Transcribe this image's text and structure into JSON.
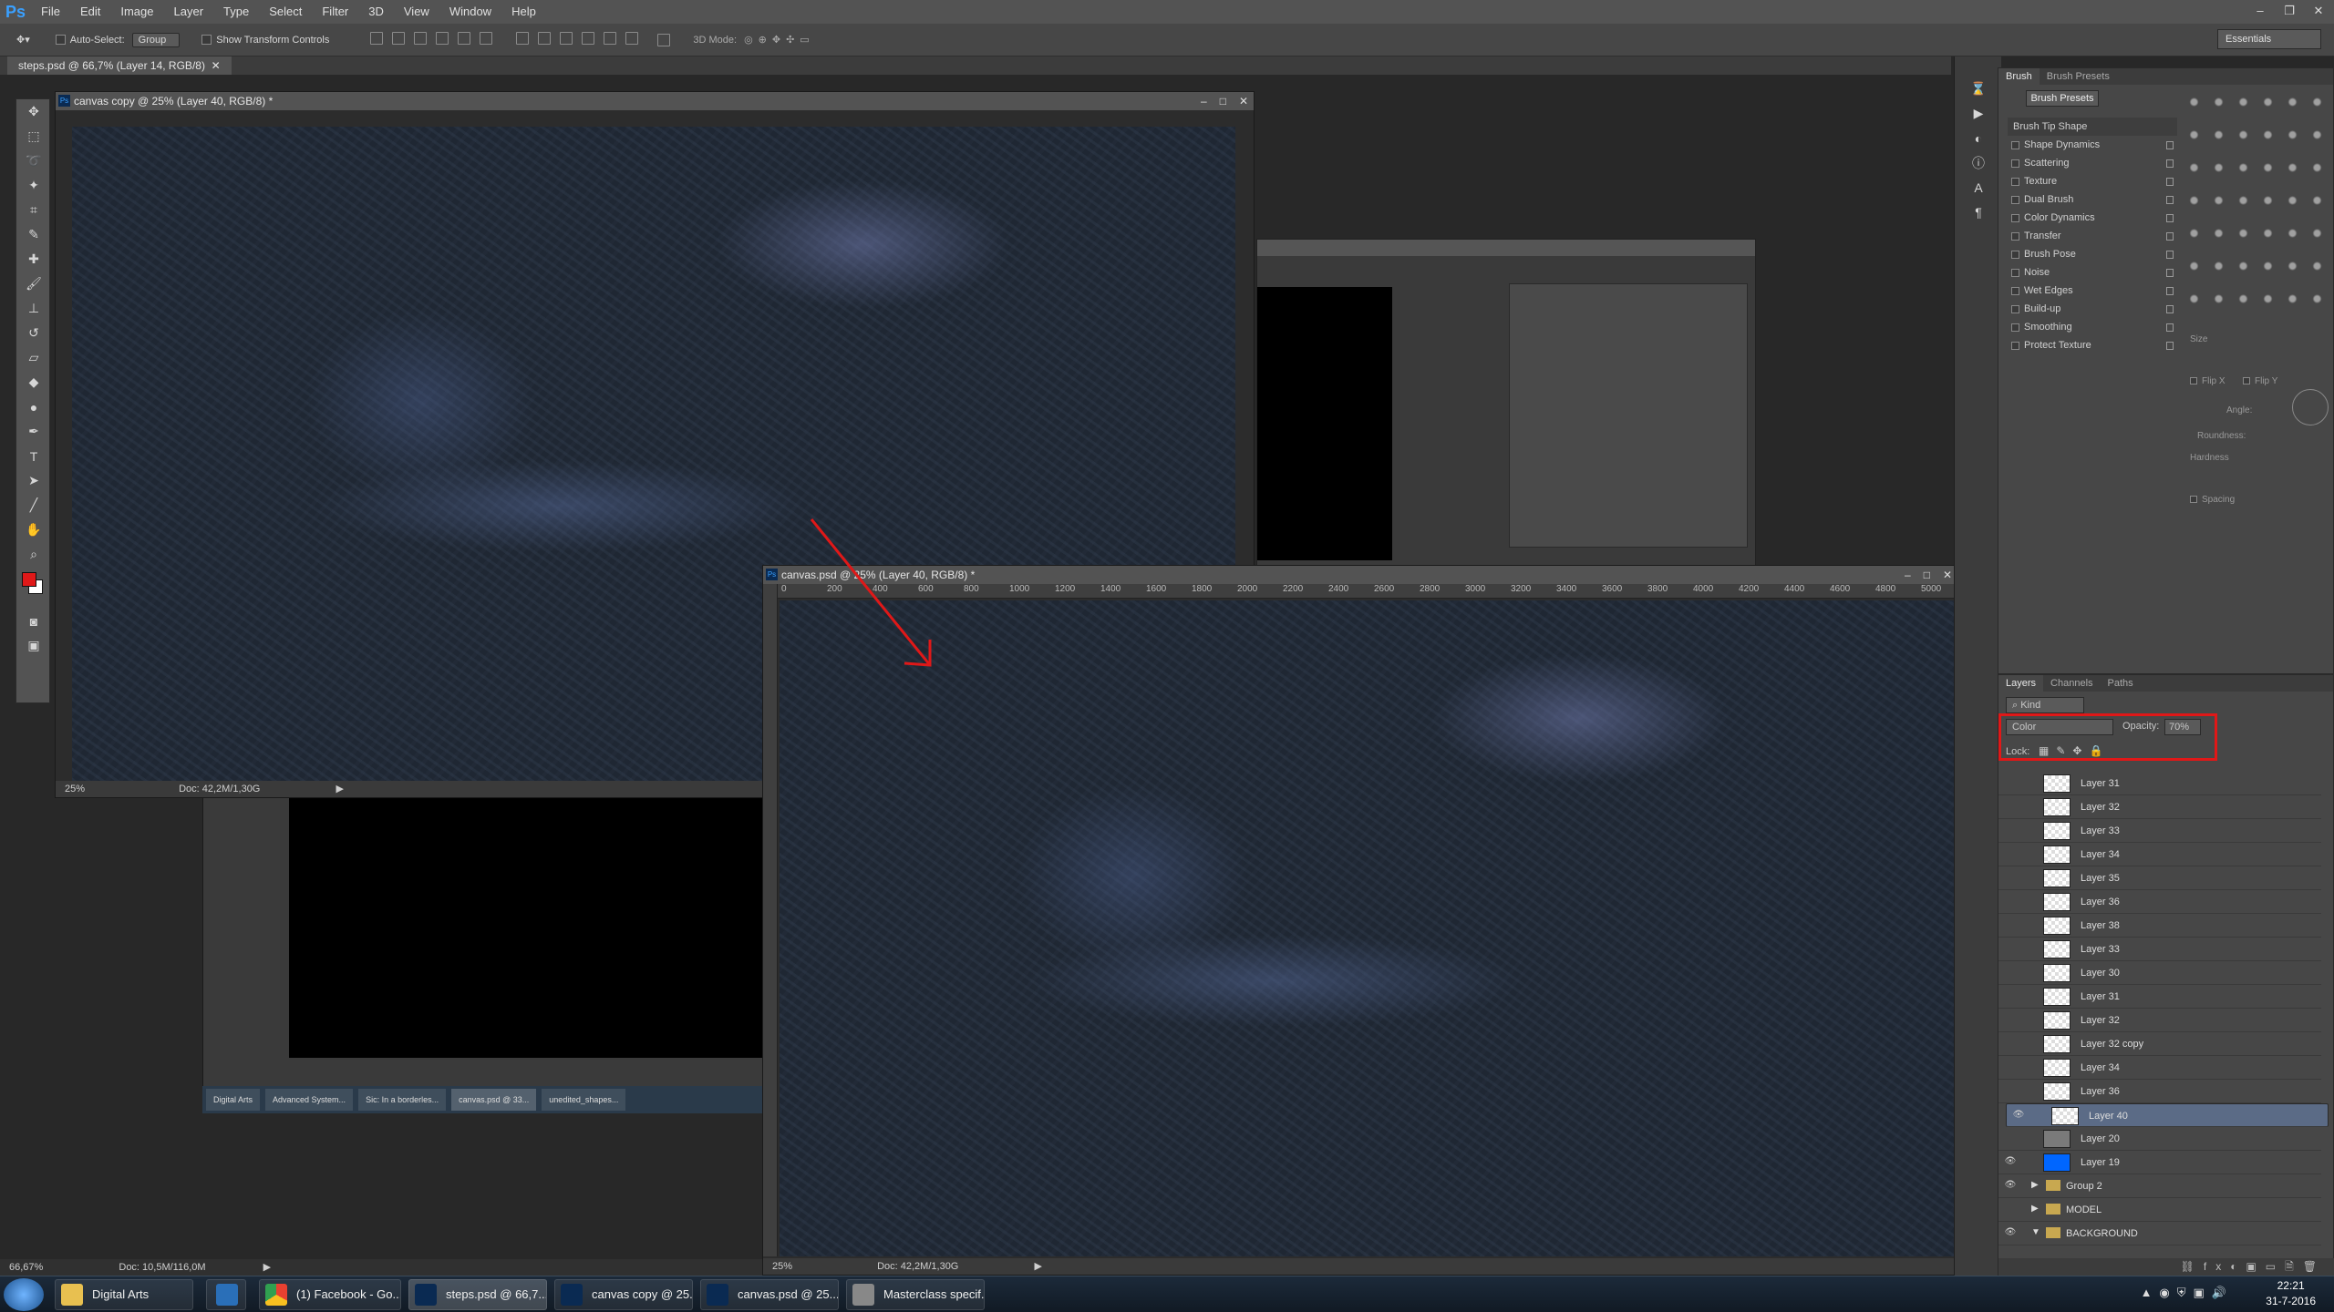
{
  "app": {
    "logo": "Ps"
  },
  "menu": [
    "File",
    "Edit",
    "Image",
    "Layer",
    "Type",
    "Select",
    "Filter",
    "3D",
    "View",
    "Window",
    "Help"
  ],
  "options": {
    "auto_select": "Auto-Select:",
    "group_value": "Group",
    "show_transform": "Show Transform Controls",
    "mode_label": "3D Mode:",
    "workspace": "Essentials"
  },
  "doc_tab": "steps.psd @ 66,7% (Layer 14, RGB/8)",
  "windows": {
    "copy": {
      "title": "canvas copy @ 25% (Layer 40, RGB/8) *",
      "zoom": "25%",
      "doc": "Doc: 42,2M/1,30G"
    },
    "canvas": {
      "title": "canvas.psd @ 25% (Layer 40, RGB/8) *",
      "zoom": "25%",
      "doc": "Doc: 42,2M/1,30G"
    },
    "main_status": {
      "zoom": "66,67%",
      "doc": "Doc: 10,5M/116,0M"
    }
  },
  "ruler": [
    "0",
    "200",
    "400",
    "600",
    "800",
    "1000",
    "1200",
    "1400",
    "1600",
    "1800",
    "2000",
    "2200",
    "2400",
    "2600",
    "2800",
    "3000",
    "3200",
    "3400",
    "3600",
    "3800",
    "4000",
    "4200",
    "4400",
    "4600",
    "4800",
    "5000"
  ],
  "brush": {
    "tabs": [
      "Brush",
      "Brush Presets"
    ],
    "presets_button": "Brush Presets",
    "items": [
      "Brush Tip Shape",
      "Shape Dynamics",
      "Scattering",
      "Texture",
      "Dual Brush",
      "Color Dynamics",
      "Transfer",
      "Brush Pose",
      "Noise",
      "Wet Edges",
      "Build-up",
      "Smoothing",
      "Protect Texture"
    ],
    "size": "Size",
    "flip_x": "Flip X",
    "flip_y": "Flip Y",
    "angle": "Angle:",
    "roundness": "Roundness:",
    "hardness": "Hardness",
    "spacing": "Spacing"
  },
  "layers": {
    "tabs": [
      "Layers",
      "Channels",
      "Paths"
    ],
    "kind": "Kind",
    "blend": "Color",
    "opacity_label": "Opacity:",
    "opacity": "70%",
    "lock": "Lock:",
    "rows": [
      {
        "name": "Layer 31",
        "vis": false
      },
      {
        "name": "Layer 32",
        "vis": false
      },
      {
        "name": "Layer 33",
        "vis": false
      },
      {
        "name": "Layer 34",
        "vis": false
      },
      {
        "name": "Layer 35",
        "vis": false
      },
      {
        "name": "Layer 36",
        "vis": false
      },
      {
        "name": "Layer 38",
        "vis": false
      },
      {
        "name": "Layer 33",
        "vis": false
      },
      {
        "name": "Layer 30",
        "vis": false
      },
      {
        "name": "Layer 31",
        "vis": false
      },
      {
        "name": "Layer 32",
        "vis": false
      },
      {
        "name": "Layer 32 copy",
        "vis": false
      },
      {
        "name": "Layer 34",
        "vis": false
      },
      {
        "name": "Layer 36",
        "vis": false
      },
      {
        "name": "Layer 40",
        "vis": true,
        "selected": true
      },
      {
        "name": "Layer 20",
        "vis": false
      },
      {
        "name": "Layer 19",
        "vis": true
      },
      {
        "name": "Group 2",
        "vis": true,
        "group": true
      },
      {
        "name": "MODEL",
        "vis": false,
        "group": true
      },
      {
        "name": "BACKGROUND",
        "vis": true,
        "group": true
      }
    ]
  },
  "inner_taskbar": [
    "Digital Arts",
    "Advanced System...",
    "Sic: In a borderles...",
    "canvas.psd @ 33...",
    "unedited_shapes..."
  ],
  "taskbar": {
    "items": [
      "Digital Arts",
      "(1) Facebook - Go...",
      "steps.psd @ 66,7...",
      "canvas copy @ 25...",
      "canvas.psd @ 25...",
      "Masterclass specif..."
    ],
    "time": "22:21",
    "date": "31-7-2016"
  },
  "colors": {
    "accent": "#e01818",
    "foreground": "#e01818",
    "background": "#ffffff",
    "layer19": "#0066ff"
  }
}
